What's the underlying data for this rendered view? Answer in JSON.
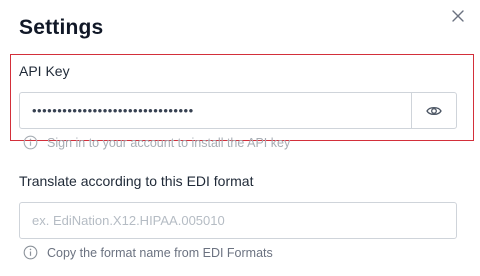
{
  "dialog": {
    "title": "Settings",
    "close_icon": "close-icon"
  },
  "api_key": {
    "label": "API Key",
    "value": "••••••••••••••••••••••••••••••••",
    "reveal_icon": "eye-icon",
    "hint": "Sign in to your account to install the API key",
    "hint_icon": "info-icon"
  },
  "edi_format": {
    "label": "Translate according to this EDI format",
    "placeholder": "ex. EdiNation.X12.HIPAA.005010",
    "value": "",
    "hint": "Copy the format name from EDI Formats",
    "hint_icon": "info-icon"
  },
  "colors": {
    "highlight_border": "#d32f3a",
    "input_border": "#cfd4da",
    "hint_text": "#9aa1a9"
  }
}
